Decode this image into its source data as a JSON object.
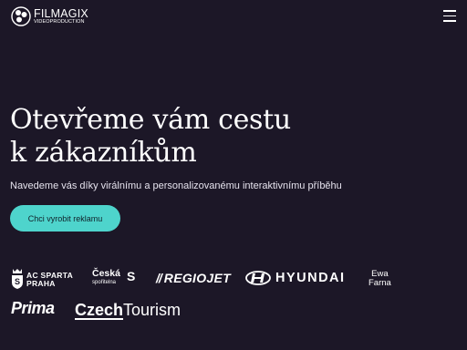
{
  "header": {
    "brand_name": "FILMAGIX",
    "brand_sub": "VIDEOPRODUCTION",
    "logo_icon": "film-reel-icon",
    "menu_icon": "hamburger-menu-icon"
  },
  "hero": {
    "title_line1": "Otevřeme vám cestu",
    "title_line2": "k zákazníkům",
    "subtitle": "Navedeme vás díky virálnímu a personalizovanému interaktivnímu příběhu",
    "cta_label": "Chci vyrobit reklamu"
  },
  "clients": {
    "sparta_line1": "AC SPARTA",
    "sparta_line2": "PRAHA",
    "ceska_line1": "Česká",
    "ceska_line2": "spořitelna",
    "ceska_mark": "S",
    "regiojet_bars": "//",
    "regiojet": "REGIOJET",
    "hyundai": "HYUNDAI",
    "ewa_line1": "Ewa",
    "ewa_line2": "Farna",
    "prima": "Prima",
    "czech_part1": "Czech",
    "czech_part2": "Tourism"
  },
  "colors": {
    "background": "#1c1727",
    "accent": "#4ed4cc",
    "text": "#ffffff"
  }
}
